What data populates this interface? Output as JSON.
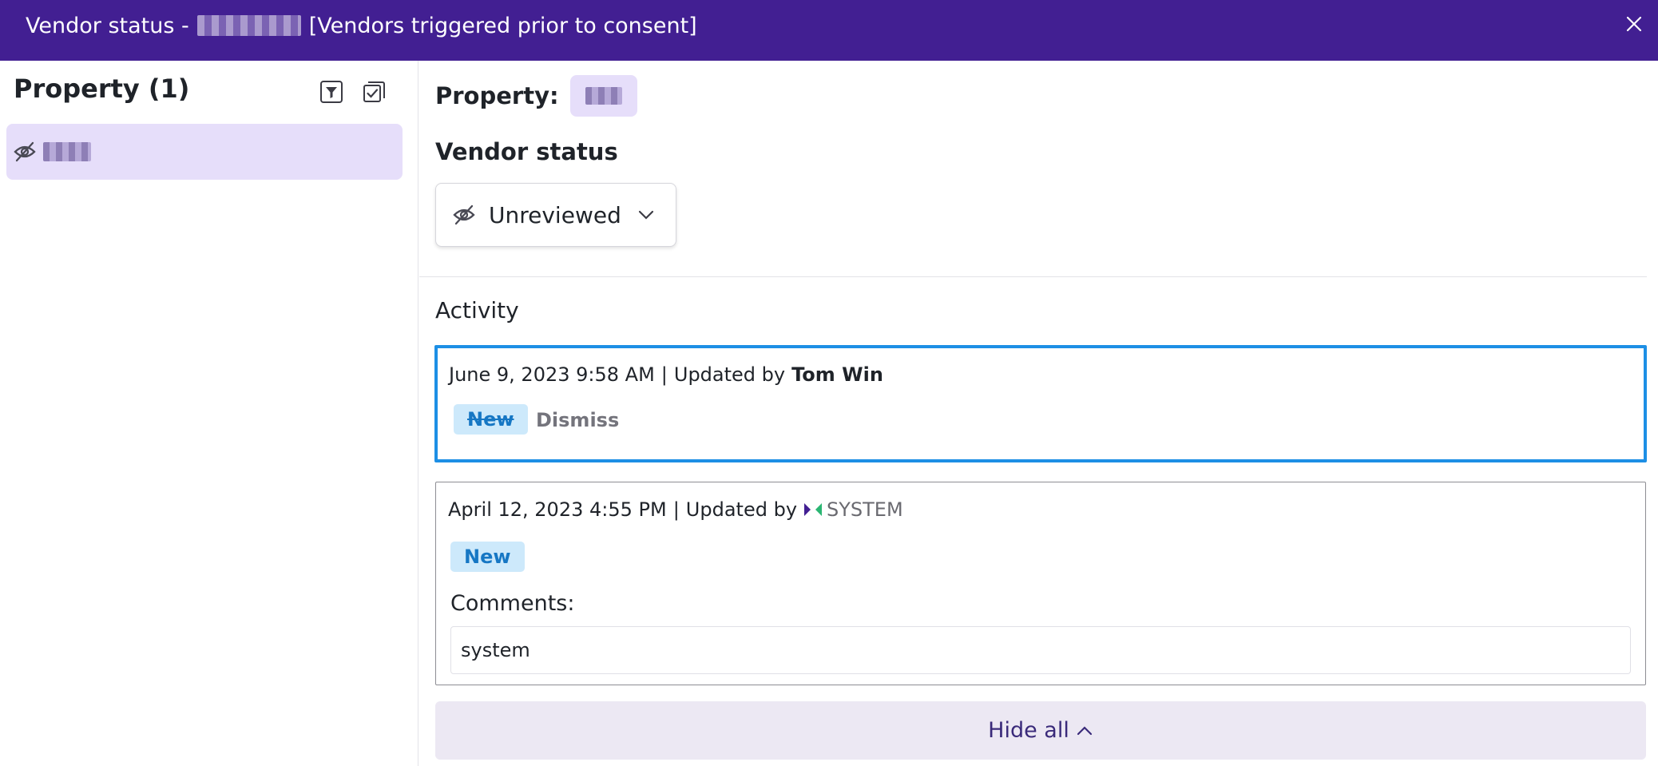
{
  "header": {
    "title_prefix": "Vendor status - ",
    "title_suffix": "[Vendors triggered prior to consent]",
    "background_color": "#421f92"
  },
  "left_panel": {
    "title": "Property (1)",
    "icons": [
      "filter-icon",
      "select-all-icon"
    ],
    "items": [
      {
        "icon": "eye-off-icon",
        "selected": true
      }
    ]
  },
  "right_panel": {
    "property_label": "Property:",
    "vendor_status_label": "Vendor status",
    "status_dropdown": {
      "value": "Unreviewed",
      "icon": "eye-off-icon"
    },
    "activity_label": "Activity",
    "activities": [
      {
        "date": "June 9, 2023 9:58 AM",
        "separator": "|",
        "updated_by_label": "Updated by",
        "user": "Tom Win",
        "badge": "New",
        "badge_struck": true,
        "dismiss_label": "Dismiss",
        "highlighted": true
      },
      {
        "date": "April 12, 2023 4:55 PM",
        "separator": "|",
        "updated_by_label": "Updated by",
        "user": "SYSTEM",
        "badge": "New",
        "comments_label": "Comments:",
        "comments_value": "system"
      }
    ],
    "hide_all_label": "Hide all"
  },
  "colors": {
    "accent": "#421f92",
    "selection_bg": "#e6defa",
    "highlight_border": "#1d8fe5",
    "badge_bg": "#cde9fb",
    "badge_text": "#1677c4"
  }
}
